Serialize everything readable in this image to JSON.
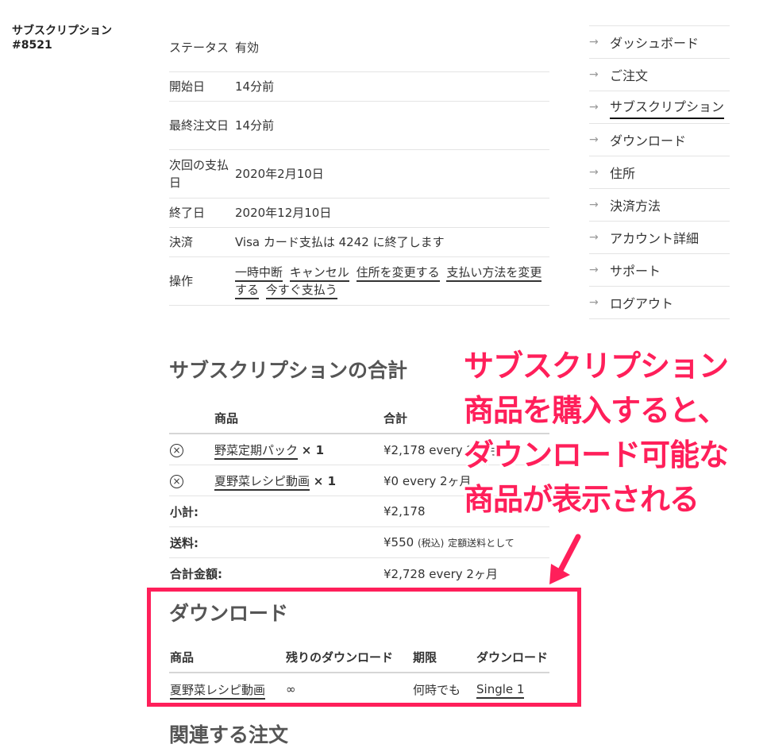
{
  "page_title": {
    "line1": "サブスクリプション",
    "line2": "#8521"
  },
  "details": [
    {
      "label": "ステータス",
      "value": "有効"
    },
    {
      "label": "開始日",
      "value": "14分前"
    },
    {
      "label": "最終注文日",
      "value": "14分前"
    },
    {
      "label": "次回の支払日",
      "value": "2020年2月10日"
    },
    {
      "label": "終了日",
      "value": "2020年12月10日"
    },
    {
      "label": "決済",
      "value": "Visa カード支払は 4242 に終了します"
    }
  ],
  "actions": {
    "label": "操作",
    "items": [
      "一時中断",
      "キャンセル",
      "住所を変更する",
      "支払い方法を変更する",
      "今すぐ支払う"
    ]
  },
  "totals": {
    "title": "サブスクリプションの合計",
    "headers": {
      "product": "商品",
      "total": "合計"
    },
    "items": [
      {
        "name": "野菜定期パック",
        "qty": "× 1",
        "total": "¥2,178 every 2ヶ月"
      },
      {
        "name": "夏野菜レシピ動画",
        "qty": "× 1",
        "total": "¥0 every 2ヶ月"
      }
    ],
    "subtotal": {
      "label": "小計:",
      "value": "¥2,178"
    },
    "shipping": {
      "label": "送料:",
      "value": "¥550",
      "tax": "(税込)",
      "note": "定額送料として"
    },
    "grand": {
      "label": "合計金額:",
      "value": "¥2,728 every 2ヶ月"
    },
    "remove_icon": "circle-x-icon"
  },
  "downloads": {
    "title": "ダウンロード",
    "headers": {
      "product": "商品",
      "remaining": "残りのダウンロード",
      "expires": "期限",
      "download": "ダウンロード"
    },
    "rows": [
      {
        "product": "夏野菜レシピ動画",
        "remaining": "∞",
        "expires": "何時でも",
        "download": "Single 1"
      }
    ]
  },
  "related_title": "関連する注文",
  "nav": {
    "items": [
      {
        "label": "ダッシュボード"
      },
      {
        "label": "ご注文"
      },
      {
        "label": "サブスクリプション",
        "active": true
      },
      {
        "label": "ダウンロード"
      },
      {
        "label": "住所"
      },
      {
        "label": "決済方法"
      },
      {
        "label": "アカウント詳細"
      },
      {
        "label": "サポート"
      },
      {
        "label": "ログアウト"
      }
    ],
    "arrow_icon": "arrow-right-icon"
  },
  "annotation": {
    "lines": [
      "サブスクリプション",
      "商品を購入すると、",
      "ダウンロード可能な",
      "商品が表示される"
    ],
    "color": "#ff1f5a"
  }
}
